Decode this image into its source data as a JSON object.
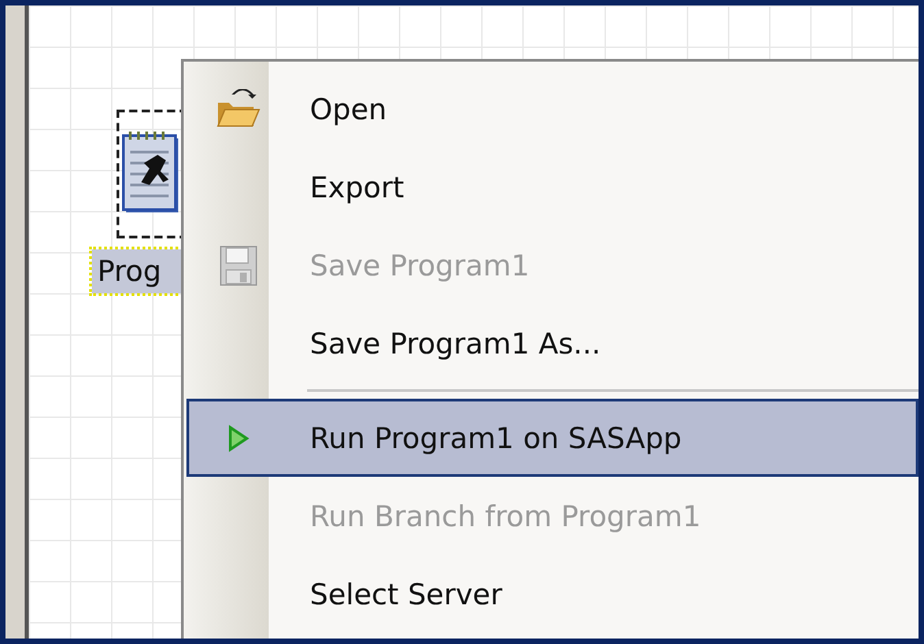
{
  "canvas": {
    "node": {
      "label": "Prog",
      "selected": true
    }
  },
  "context_menu": {
    "items": [
      {
        "kind": "item",
        "label": "Open",
        "disabled": false,
        "selected": false
      },
      {
        "kind": "item",
        "label": "Export",
        "disabled": false,
        "selected": false
      },
      {
        "kind": "item",
        "label": "Save Program1",
        "disabled": true,
        "selected": false
      },
      {
        "kind": "item",
        "label": "Save Program1 As...",
        "disabled": false,
        "selected": false
      },
      {
        "kind": "separator"
      },
      {
        "kind": "item",
        "label": "Run Program1 on SASApp",
        "disabled": false,
        "selected": true
      },
      {
        "kind": "item",
        "label": "Run Branch from Program1",
        "disabled": true,
        "selected": false
      },
      {
        "kind": "item",
        "label": "Select Server",
        "disabled": false,
        "selected": false
      }
    ]
  }
}
